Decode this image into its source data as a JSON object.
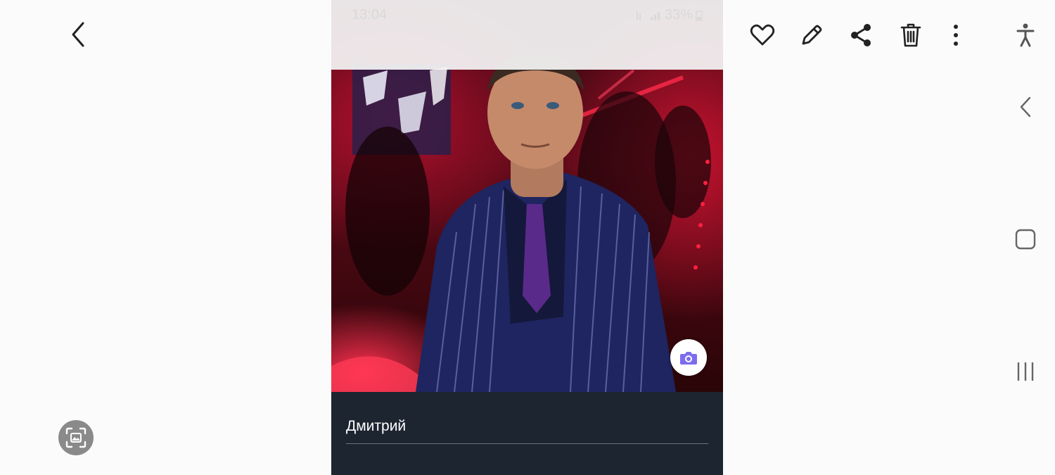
{
  "viewer_toolbar": {
    "back_icon": "chevron-left-icon",
    "actions": [
      "heart-icon",
      "pencil-icon",
      "share-icon",
      "trash-icon",
      "more-vertical-icon"
    ]
  },
  "nav_bar": {
    "icons": [
      "accessibility-icon",
      "back-chevron-icon",
      "home-square-icon",
      "recents-icon"
    ]
  },
  "phone_screenshot": {
    "status_bar": {
      "time": "13:04",
      "battery": "33%"
    },
    "profile_name": "Дмитрий",
    "accent_color": "#7c6cf0",
    "panel_color": "#1d2531"
  },
  "scan_button": {
    "icon": "image-scan-icon"
  }
}
